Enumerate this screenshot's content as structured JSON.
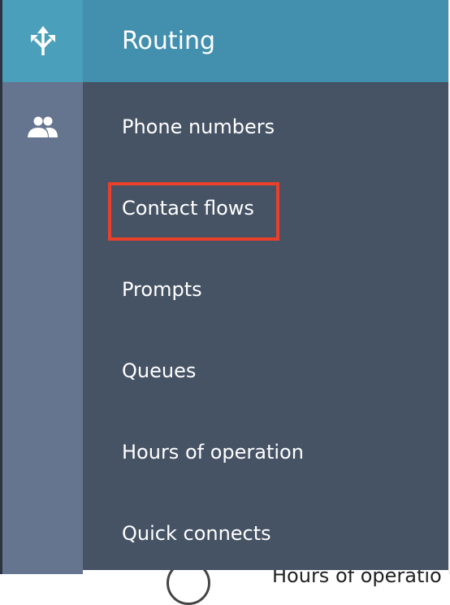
{
  "rail": {
    "items": [
      {
        "icon": "routing-icon",
        "active": true
      },
      {
        "icon": "users-icon",
        "active": false
      }
    ]
  },
  "menu": {
    "title": "Routing",
    "items": [
      {
        "label": "Phone numbers"
      },
      {
        "label": "Contact flows",
        "highlighted": true
      },
      {
        "label": "Prompts"
      },
      {
        "label": "Queues"
      },
      {
        "label": "Hours of operation"
      },
      {
        "label": "Quick connects"
      }
    ]
  },
  "background": {
    "partial_text": "Hours of operatio"
  },
  "colors": {
    "highlight": "#e8402a",
    "active": "#4a9fbb",
    "panel": "#465365"
  }
}
